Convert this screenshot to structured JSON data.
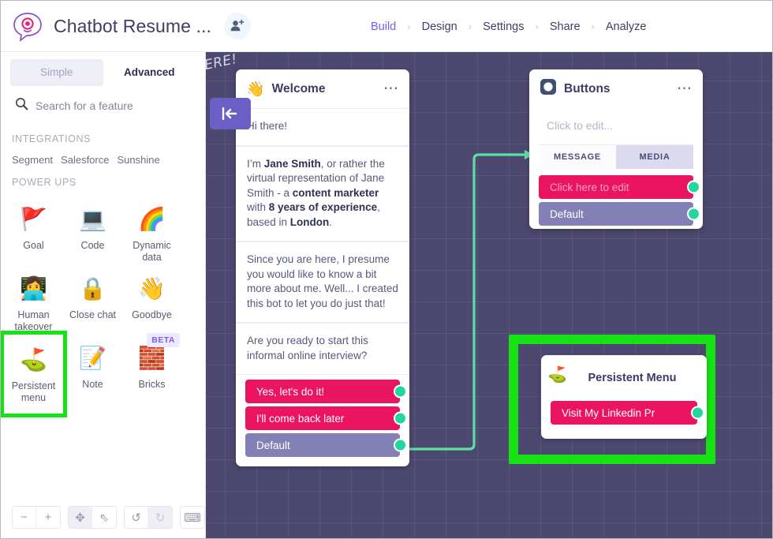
{
  "header": {
    "logo_icon": "chatbot-bubble-logo",
    "title": "Chatbot Resume ...",
    "invite_icon": "add-person-icon",
    "nav": [
      {
        "label": "Build",
        "active": true
      },
      {
        "label": "Design",
        "active": false
      },
      {
        "label": "Settings",
        "active": false
      },
      {
        "label": "Share",
        "active": false
      },
      {
        "label": "Analyze",
        "active": false
      }
    ],
    "nav_separator": "›",
    "accent_color": "#7b5cf0"
  },
  "sidebar": {
    "tabs": [
      {
        "label": "Simple",
        "selected": true
      },
      {
        "label": "Advanced",
        "selected": false
      }
    ],
    "search": {
      "icon": "search-icon",
      "placeholder": "Search for a feature",
      "value": ""
    },
    "integrations": {
      "heading": "INTEGRATIONS",
      "items": [
        "Segment",
        "Salesforce",
        "Sunshine"
      ]
    },
    "powerups": {
      "heading": "POWER UPS",
      "items": [
        {
          "label": "Goal",
          "glyph": "🚩",
          "icon": "red-flag-icon",
          "highlighted": false,
          "badge": ""
        },
        {
          "label": "Code",
          "glyph": "💻",
          "icon": "laptop-icon",
          "highlighted": false,
          "badge": ""
        },
        {
          "label": "Dynamic data",
          "glyph": "🌈",
          "icon": "rainbow-icon",
          "highlighted": false,
          "badge": ""
        },
        {
          "label": "Human takeover",
          "glyph": "👩‍💻",
          "icon": "person-at-laptop-icon",
          "highlighted": false,
          "badge": ""
        },
        {
          "label": "Close chat",
          "glyph": "🔒",
          "icon": "lock-icon",
          "highlighted": false,
          "badge": ""
        },
        {
          "label": "Goodbye",
          "glyph": "👋",
          "icon": "waving-hand-icon",
          "highlighted": false,
          "badge": ""
        },
        {
          "label": "Persistent menu",
          "glyph": "⛳",
          "icon": "flag-in-hole-icon",
          "highlighted": true,
          "badge": ""
        },
        {
          "label": "Note",
          "glyph": "📝",
          "icon": "memo-icon",
          "highlighted": false,
          "badge": ""
        },
        {
          "label": "Bricks",
          "glyph": "🧱",
          "icon": "brick-icon",
          "highlighted": false,
          "badge": "BETA"
        }
      ]
    },
    "toolbar": [
      {
        "icon": "zoom-out-icon",
        "glyph": "−",
        "state": "normal"
      },
      {
        "icon": "zoom-in-icon",
        "glyph": "+",
        "state": "normal"
      },
      {
        "icon": "pan-move-icon",
        "glyph": "✥",
        "state": "active"
      },
      {
        "icon": "pointer-cursor-icon",
        "glyph": "⇖",
        "state": "normal"
      },
      {
        "icon": "undo-icon",
        "glyph": "↺",
        "state": "normal"
      },
      {
        "icon": "redo-icon",
        "glyph": "↻",
        "state": "disabled"
      },
      {
        "icon": "keyboard-shortcuts-icon",
        "glyph": "⌨",
        "state": "normal"
      }
    ]
  },
  "canvas": {
    "background_color": "#4c4870",
    "handwritten_note": "ERE!",
    "collapse_icon": "collapse-panel-icon",
    "collapse_glyph": "⇤",
    "highlight_color": "#16e216",
    "connector_color": "#5fdfa0",
    "welcome_card": {
      "icon": "waving-hand-icon",
      "icon_glyph": "👋",
      "title": "Welcome",
      "menu_icon": "more-options-icon",
      "messages": [
        {
          "html": "Hi there!"
        },
        {
          "html": "I’m <b>Jane Smith</b>, or rather the virtual representation of Jane Smith - a <b>content marketer</b> with <b>8 years of experience</b>, based in <b>London</b>."
        },
        {
          "html": "Since you are here, I presume you would like to know a bit more about me. Well... I created this bot to let you do just that!"
        },
        {
          "html": "Are you ready to start this informal online interview?"
        }
      ],
      "buttons": [
        {
          "label": "Yes, let's do it!",
          "style": "pink"
        },
        {
          "label": "I'll come back later",
          "style": "pink"
        },
        {
          "label": "Default",
          "style": "purple"
        }
      ]
    },
    "buttons_card": {
      "icon": "square-block-icon",
      "title": "Buttons",
      "menu_icon": "more-options-icon",
      "edit_placeholder": "Click to edit...",
      "segments": [
        {
          "label": "MESSAGE",
          "selected": true
        },
        {
          "label": "MEDIA",
          "selected": false
        }
      ],
      "buttons": [
        {
          "label": "Click here to edit",
          "style": "pink-ghost"
        },
        {
          "label": "Default",
          "style": "purple"
        }
      ]
    },
    "persistent_menu_card": {
      "icon": "flag-in-hole-icon",
      "icon_glyph": "⛳",
      "title": "Persistent Menu",
      "buttons": [
        {
          "label": "Visit My Linkedin Pr",
          "style": "pink"
        }
      ]
    }
  }
}
